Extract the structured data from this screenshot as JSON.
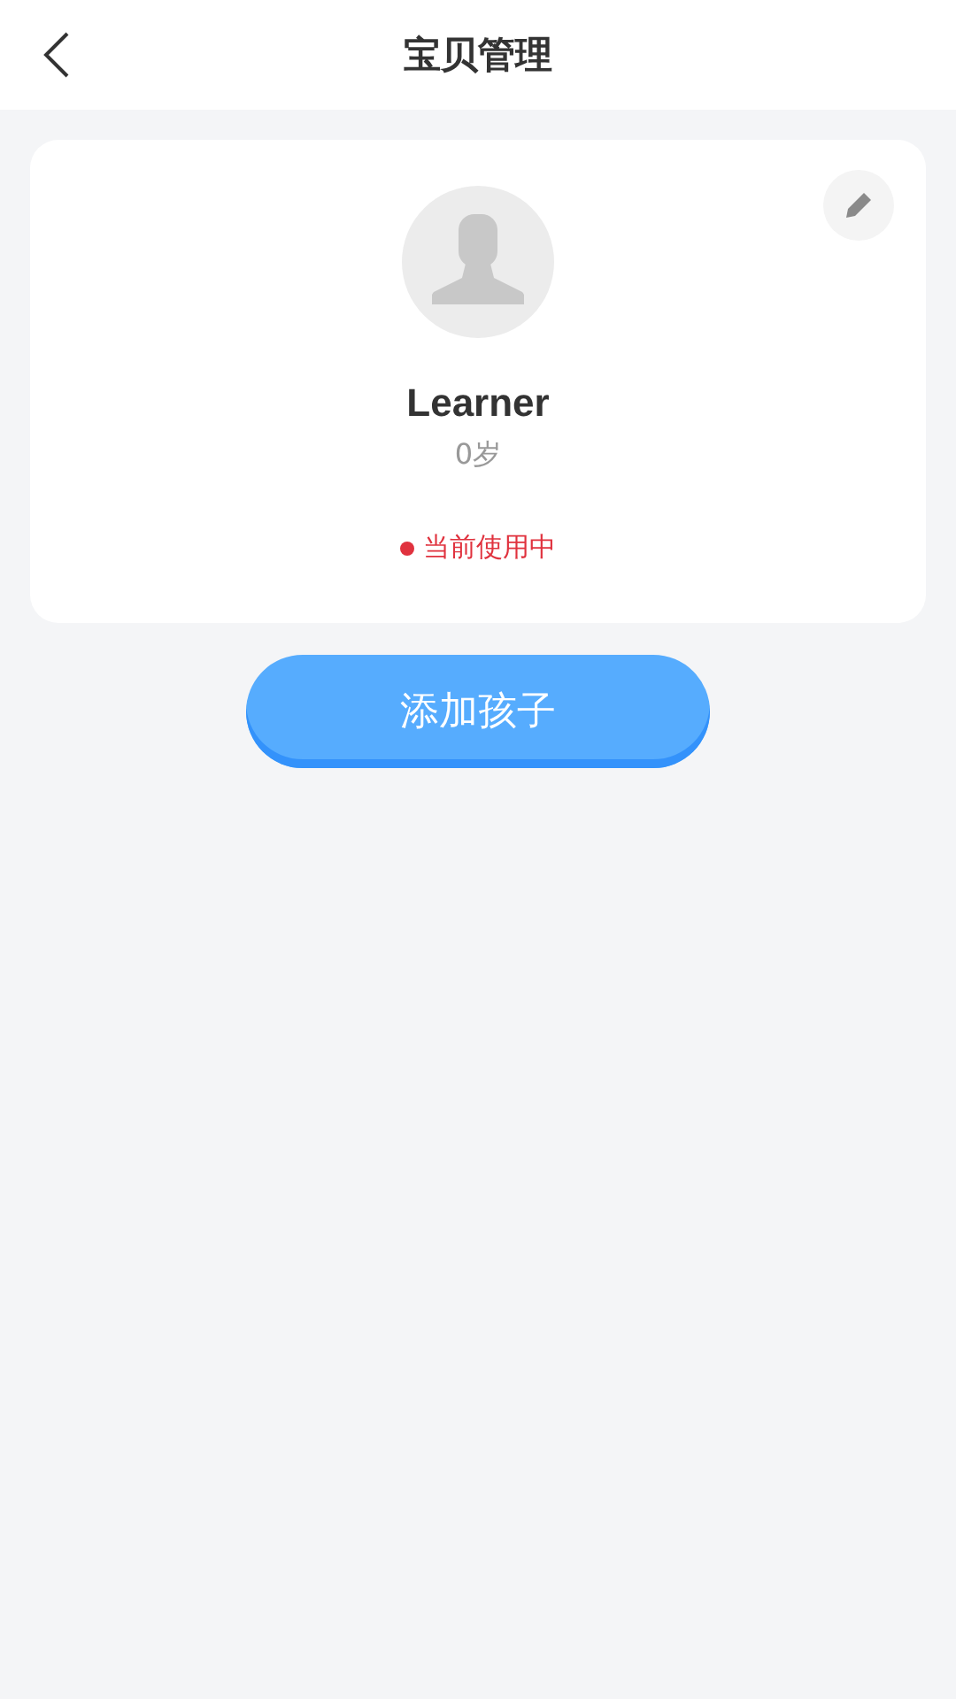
{
  "header": {
    "title": "宝贝管理"
  },
  "children": [
    {
      "name": "Learner",
      "age": "0岁",
      "status": "当前使用中",
      "in_use": true
    }
  ],
  "add_button": {
    "label": "添加孩子"
  }
}
